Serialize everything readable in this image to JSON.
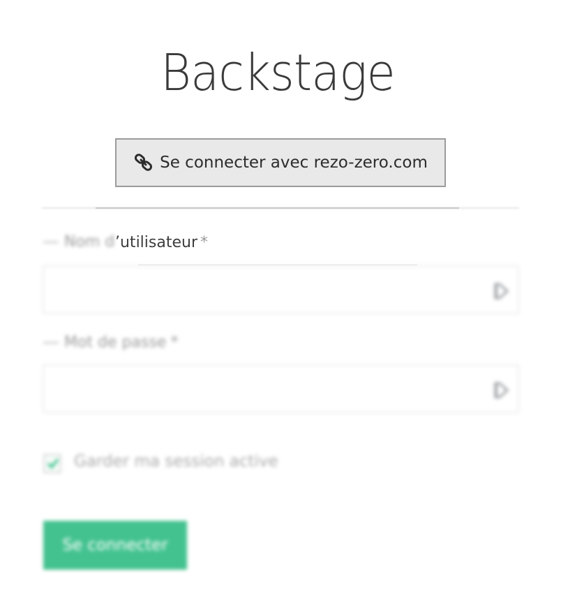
{
  "header": {
    "title": "Backstage"
  },
  "oauth": {
    "icon": "link-icon",
    "label": "Se connecter avec rezo-zero.com"
  },
  "form": {
    "username": {
      "label_prefix": "Nom d",
      "label": "’utilisateur",
      "required_mark": "*",
      "value": "",
      "icon": "login-icon"
    },
    "password": {
      "label": "Mot de passe",
      "required_mark": "*",
      "value": "",
      "icon": "login-icon"
    },
    "remember": {
      "label": "Garder ma session active",
      "checked": true
    },
    "submit": {
      "label": "Se connecter"
    }
  },
  "colors": {
    "accent": "#43c28f",
    "title": "#3a3a3a"
  }
}
